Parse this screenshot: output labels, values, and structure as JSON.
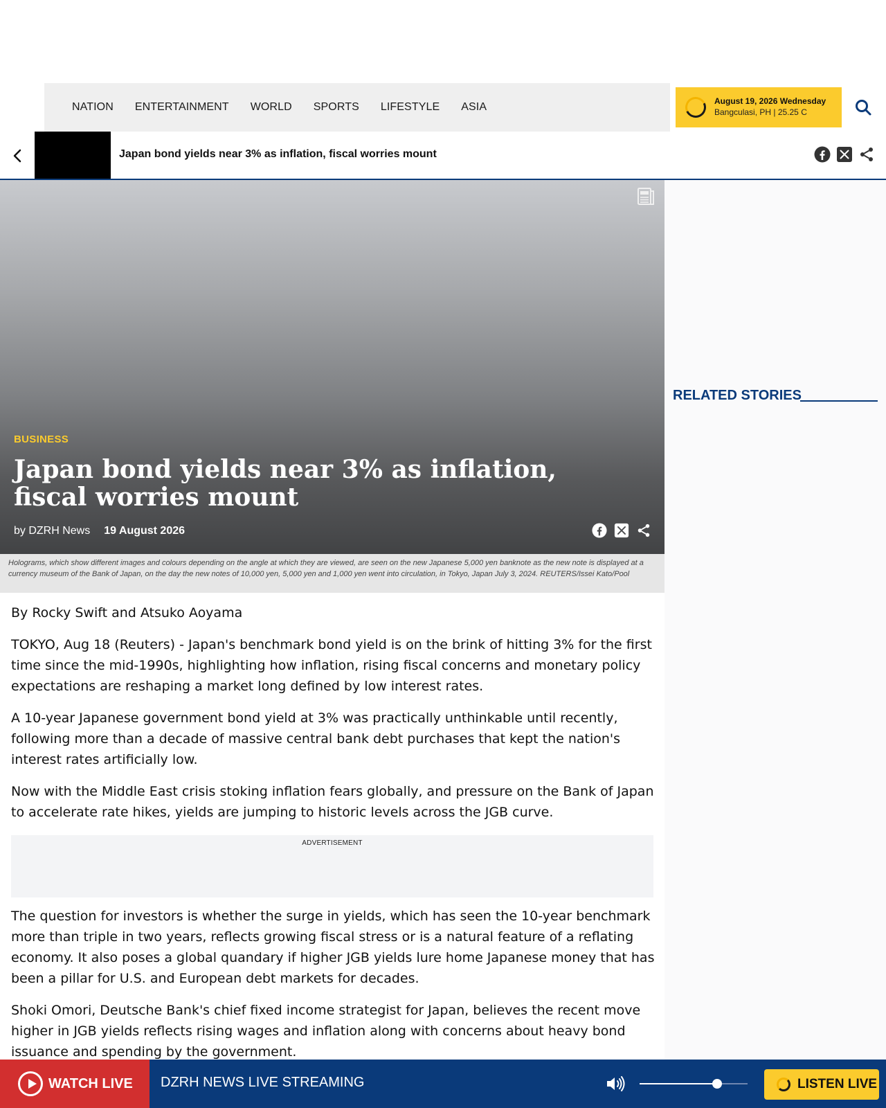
{
  "nav": {
    "items": [
      "NATION",
      "ENTERTAINMENT",
      "WORLD",
      "SPORTS",
      "LIFESTYLE",
      "ASIA"
    ],
    "weather": {
      "date": "August 19, 2026 Wednesday",
      "location": "Bangculasi, PH | 25.25 C"
    },
    "search_icon": "search-icon"
  },
  "titlebar": {
    "title": "Japan bond yields near 3% as inflation, fiscal worries mount",
    "share_icons": [
      "facebook-icon",
      "x-icon",
      "share-icon"
    ]
  },
  "hero": {
    "category": "BUSINESS",
    "title": "Japan bond yields near 3% as inflation, fiscal worries mount",
    "author": "by DZRH News",
    "date": "19 August 2026",
    "caption": "Holograms, which show different images and colours depending on the angle at which they are viewed, are seen on the new Japanese 5,000 yen banknote as the new note is displayed at a currency museum of the Bank of Japan, on the day the new notes of 10,000 yen, 5,000 yen and 1,000 yen went into circulation, in Tokyo, Japan July 3, 2024. REUTERS/Issei Kato/Pool"
  },
  "article": {
    "paragraphs": [
      "By Rocky Swift and Atsuko Aoyama",
      "TOKYO, Aug 18 (Reuters) - Japan's benchmark bond yield is on the brink of hitting 3% for the first time since the mid-1990s, highlighting how inflation, rising fiscal concerns and monetary policy expectations are reshaping a market long defined by low interest rates.",
      "A 10-year Japanese government bond yield at 3% was practically unthinkable until recently, following more than a decade of massive central bank debt purchases that kept the nation's interest rates artificially low.",
      "Now with the Middle East crisis stoking inflation fears globally, and pressure on the Bank of Japan to accelerate rate hikes, yields are jumping to historic levels across the JGB curve."
    ],
    "ad_label": "ADVERTISEMENT",
    "paragraphs_after_ad": [
      "The question for investors is whether the surge in yields, which has seen the 10-year benchmark more than triple in two years, reflects growing fiscal stress or is a natural feature of a reflating economy. It also poses a global quandary if higher JGB yields lure home Japanese money that has been a pillar for U.S. and European debt markets for decades.",
      "Shoki Omori, Deutsche Bank's chief fixed income strategist for Japan, believes the recent move higher in JGB yields reflects rising wages and inflation along with concerns about heavy bond issuance and spending by the government."
    ]
  },
  "sidebar": {
    "related_title": "RELATED STORIES"
  },
  "livebar": {
    "watch_label": "WATCH LIVE",
    "stream_label": "DZRH NEWS LIVE STREAMING",
    "volume_level": 0.72,
    "listen_label": "LISTEN LIVE"
  },
  "colors": {
    "brand_blue": "#0a3a7a",
    "accent_yellow": "#fbcb2d",
    "live_red": "#d22f2f"
  }
}
